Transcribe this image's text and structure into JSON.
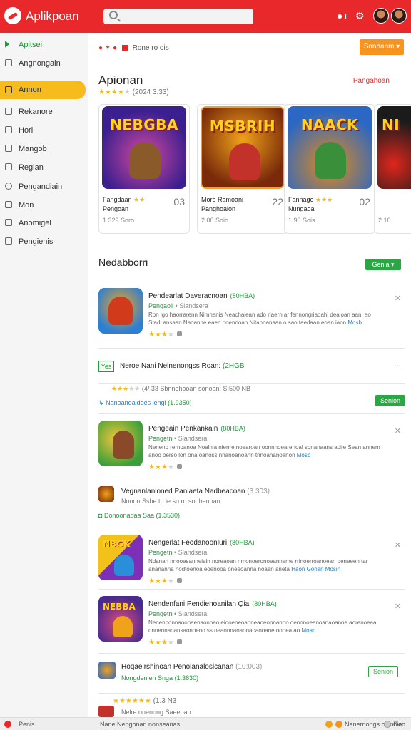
{
  "app": {
    "title": "Aplikpoan"
  },
  "search": {
    "placeholder": ""
  },
  "header_icons": [
    "add-alert-icon",
    "gear-icon",
    "avatar",
    "avatar"
  ],
  "sidebar": {
    "items": [
      {
        "label": "Apitsei",
        "icon": "play-icon",
        "state": "green"
      },
      {
        "label": "Angnongain",
        "icon": "box-icon"
      },
      {
        "label": "Annon",
        "icon": "folder-icon",
        "state": "active"
      },
      {
        "label": "Rekanore",
        "icon": "grid-icon"
      },
      {
        "label": "Hori",
        "icon": "funnel-icon"
      },
      {
        "label": "Mangob",
        "icon": "inbox-icon"
      },
      {
        "label": "Regian",
        "icon": "list-icon"
      },
      {
        "label": "Pengandiain",
        "icon": "user-icon"
      },
      {
        "label": "Mon",
        "icon": "mail-icon"
      },
      {
        "label": "Anomigel",
        "icon": "monitor-icon"
      },
      {
        "label": "Pengienis",
        "icon": "doc-icon"
      }
    ]
  },
  "breadcrumb": {
    "text": "Rone ro ois"
  },
  "sort_button": {
    "label": "Sonhanm ▾"
  },
  "featured": {
    "title": "Apionan",
    "rating_text": "(2024 3.33)",
    "link": "Pangahoan",
    "cards": [
      {
        "art_text": "NEBGBA",
        "name": "Fangdaan",
        "sub": "Pengoan",
        "num": "03",
        "meta": "1.329 Soro",
        "bg1": "#3a1f8f",
        "bg2": "#d4499e",
        "hero": "#8a5a2b"
      },
      {
        "art_text": "MSBRIH",
        "name": "Moro Ramoani",
        "sub": "Panghoaion",
        "num": "22",
        "meta": "2.00 Soio",
        "bg1": "#f0a21a",
        "bg2": "#7a2a0a",
        "hero": "#c2322b"
      },
      {
        "art_text": "NAACK",
        "name": "Fannage",
        "sub": "Nungaoa",
        "num": "02",
        "meta": "1.90 Sois",
        "bg1": "#2b67c4",
        "bg2": "#e38a1a",
        "hero": "#3a8f3a"
      },
      {
        "art_text": "NI",
        "name": "",
        "sub": "",
        "num": "",
        "meta": "2.10",
        "bg1": "#1b1b1b",
        "bg2": "#7a1a12",
        "hero": "#e0261c"
      }
    ]
  },
  "list": {
    "title": "Nedabborri",
    "button": "Genia ▾",
    "rows": [
      {
        "title": "Pendearlat Daveracnoan",
        "tag": "(80HBA)",
        "sub": "Pengaoli",
        "sub_dim": "• Slandsera",
        "desc": "Ron lgo haorrarenn Nimnanis Neachaiean ado rlaern ar fennongriaoahi deaioan aan, ao Stadi ansaan Naoanne eaen poenooan Nitanoanaan o sao taedaan eoan iaon",
        "more": "Mosb",
        "stars": 3,
        "thumb_bg1": "#2b7fd4",
        "thumb_bg2": "#f5a31a",
        "hero": "#d23a1c"
      },
      {
        "title": "Pengeain Penkankain",
        "tag": "(80HBA)",
        "sub": "Pengetn",
        "sub_dim": "• Slandsera",
        "desc": "Neneno rernoanoa Noalnia nienre noearoan oonnnoearenoal sonanaans aoiie Sean annem anoo oerso lon ona oanoss nnanoanoann tnnoananoanon",
        "more": "Mosb",
        "stars": 3,
        "thumb_bg1": "#3a9f3a",
        "thumb_bg2": "#f0c53a",
        "hero": "#8a4a2a"
      },
      {
        "title": "Nengerlat Feodanoonluri",
        "tag": "(80HBA)",
        "sub": "Pengetn",
        "sub_dim": "• Slandsera",
        "desc": "Ndanan nnooesanneiain noreaoan nmonoeronoeanneme rrinoerroanoean oeneeen tar anananna nodtoenoa eoenooa oneeoanna noaan aneta",
        "more": "Haon Gonan Mosin",
        "stars": 3,
        "thumb_bg1": "#f2c21a",
        "thumb_bg2": "#7d2fb8",
        "hero": "#2a8fd8"
      },
      {
        "title": "Nendenfani Pendienoanilan Qia",
        "tag": "(80HBA)",
        "sub": "Pengetn",
        "sub_dim": "• Slandsera",
        "desc": "Nenennonnaoonaenaonoao eiooeneoanneaoeonnanoo oenonoeanoanaoanoe aorenoeaa onnennaoansaonoeno ss oeaonnaoaonaoaooane oooea ao",
        "more": "Moan",
        "stars": 3,
        "thumb_bg1": "#4b2a8f",
        "thumb_bg2": "#e04a7a",
        "hero": "#f0a21a"
      }
    ],
    "ad_row": {
      "badge": "Yes",
      "title": "Neroe Nani Nelnenongss Roan:",
      "tag": "(2HGB",
      "rating": "(4/ 33 Sbnnohooan sonoan: S:500 NB",
      "link": "Nanoanoaldoes lengi",
      "link_meta": "(1.9350)",
      "button": "Senion"
    },
    "mini_rows": [
      {
        "title": "Vegnanlanloned Paniaeta Nadbeacoan",
        "meta": "(3 303)",
        "sub": "Nonon Ssbe tp ie so ro sonbenoan",
        "link": "Donoonadaa Saa",
        "link_meta": "(1.3530)"
      },
      {
        "title": "Hoqaeirshinoan Penolanaloslcanan",
        "meta": "(10:003)",
        "link": "Nongdenien Snga",
        "link_meta": "(1.3830)",
        "button": "Senion"
      }
    ],
    "last_row": {
      "rating": "(1.3 N3",
      "sub": "Nelre onenong Saeeoao"
    }
  },
  "bottom_bar": {
    "left": "Penis",
    "center": "Nane Nepgonan nonseanas",
    "right": "Nanernongs cotnbie",
    "far_right": "Ooo"
  },
  "colors": {
    "brand": "#e8282a",
    "accent": "#f7941d",
    "active_nav": "#f6bb1c",
    "success": "#2aa744"
  }
}
